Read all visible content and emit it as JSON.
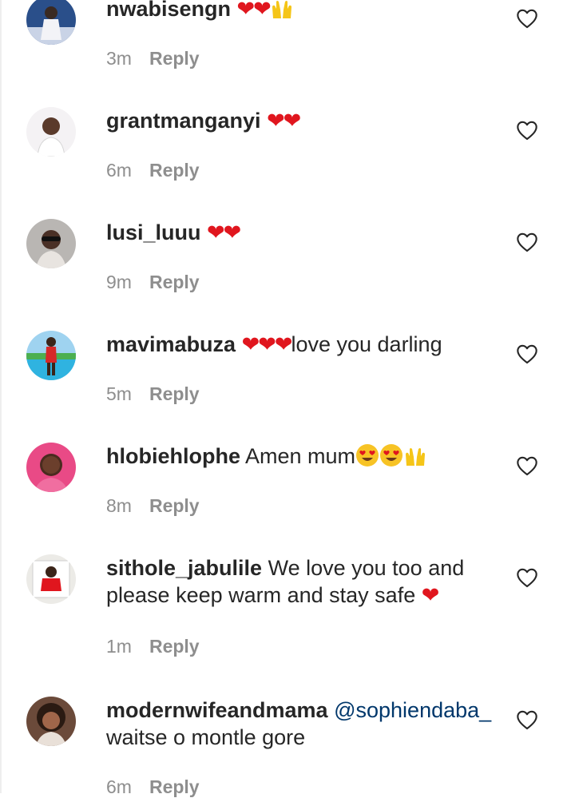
{
  "comments": [
    {
      "username": "nwabisengn",
      "text": "",
      "time": "3m",
      "reply_label": "Reply",
      "emoji": [
        "red-heart",
        "red-heart",
        "raising-hands"
      ]
    },
    {
      "username": "grantmanganyi",
      "text": "",
      "time": "6m",
      "reply_label": "Reply",
      "emoji": [
        "red-heart",
        "red-heart"
      ]
    },
    {
      "username": "lusi_luuu",
      "text": "",
      "time": "9m",
      "reply_label": "Reply",
      "emoji": [
        "red-heart",
        "red-heart"
      ]
    },
    {
      "username": "mavimabuza",
      "text": "love you darling",
      "time": "5m",
      "reply_label": "Reply",
      "emoji": [
        "red-heart",
        "red-heart",
        "red-heart"
      ]
    },
    {
      "username": "hlobiehlophe",
      "text": "Amen mum",
      "time": "8m",
      "reply_label": "Reply",
      "emoji": [
        "heart-eyes-face",
        "heart-eyes-face",
        "raising-hands"
      ]
    },
    {
      "username": "sithole_jabulile",
      "text": "We love you too and please keep warm and stay safe",
      "time": "1m",
      "reply_label": "Reply",
      "emoji": [
        "red-heart"
      ]
    },
    {
      "username": "modernwifeandmama",
      "mention": "@sophiendaba_",
      "text": "waitse o montle gore",
      "time": "6m",
      "reply_label": "Reply",
      "emoji": []
    }
  ],
  "colors": {
    "text": "#262626",
    "meta": "#8e8e8e",
    "mention": "#00376b",
    "heart": "#e0161e",
    "background": "#ffffff"
  },
  "icons": {
    "like": "heart-outline-icon"
  }
}
